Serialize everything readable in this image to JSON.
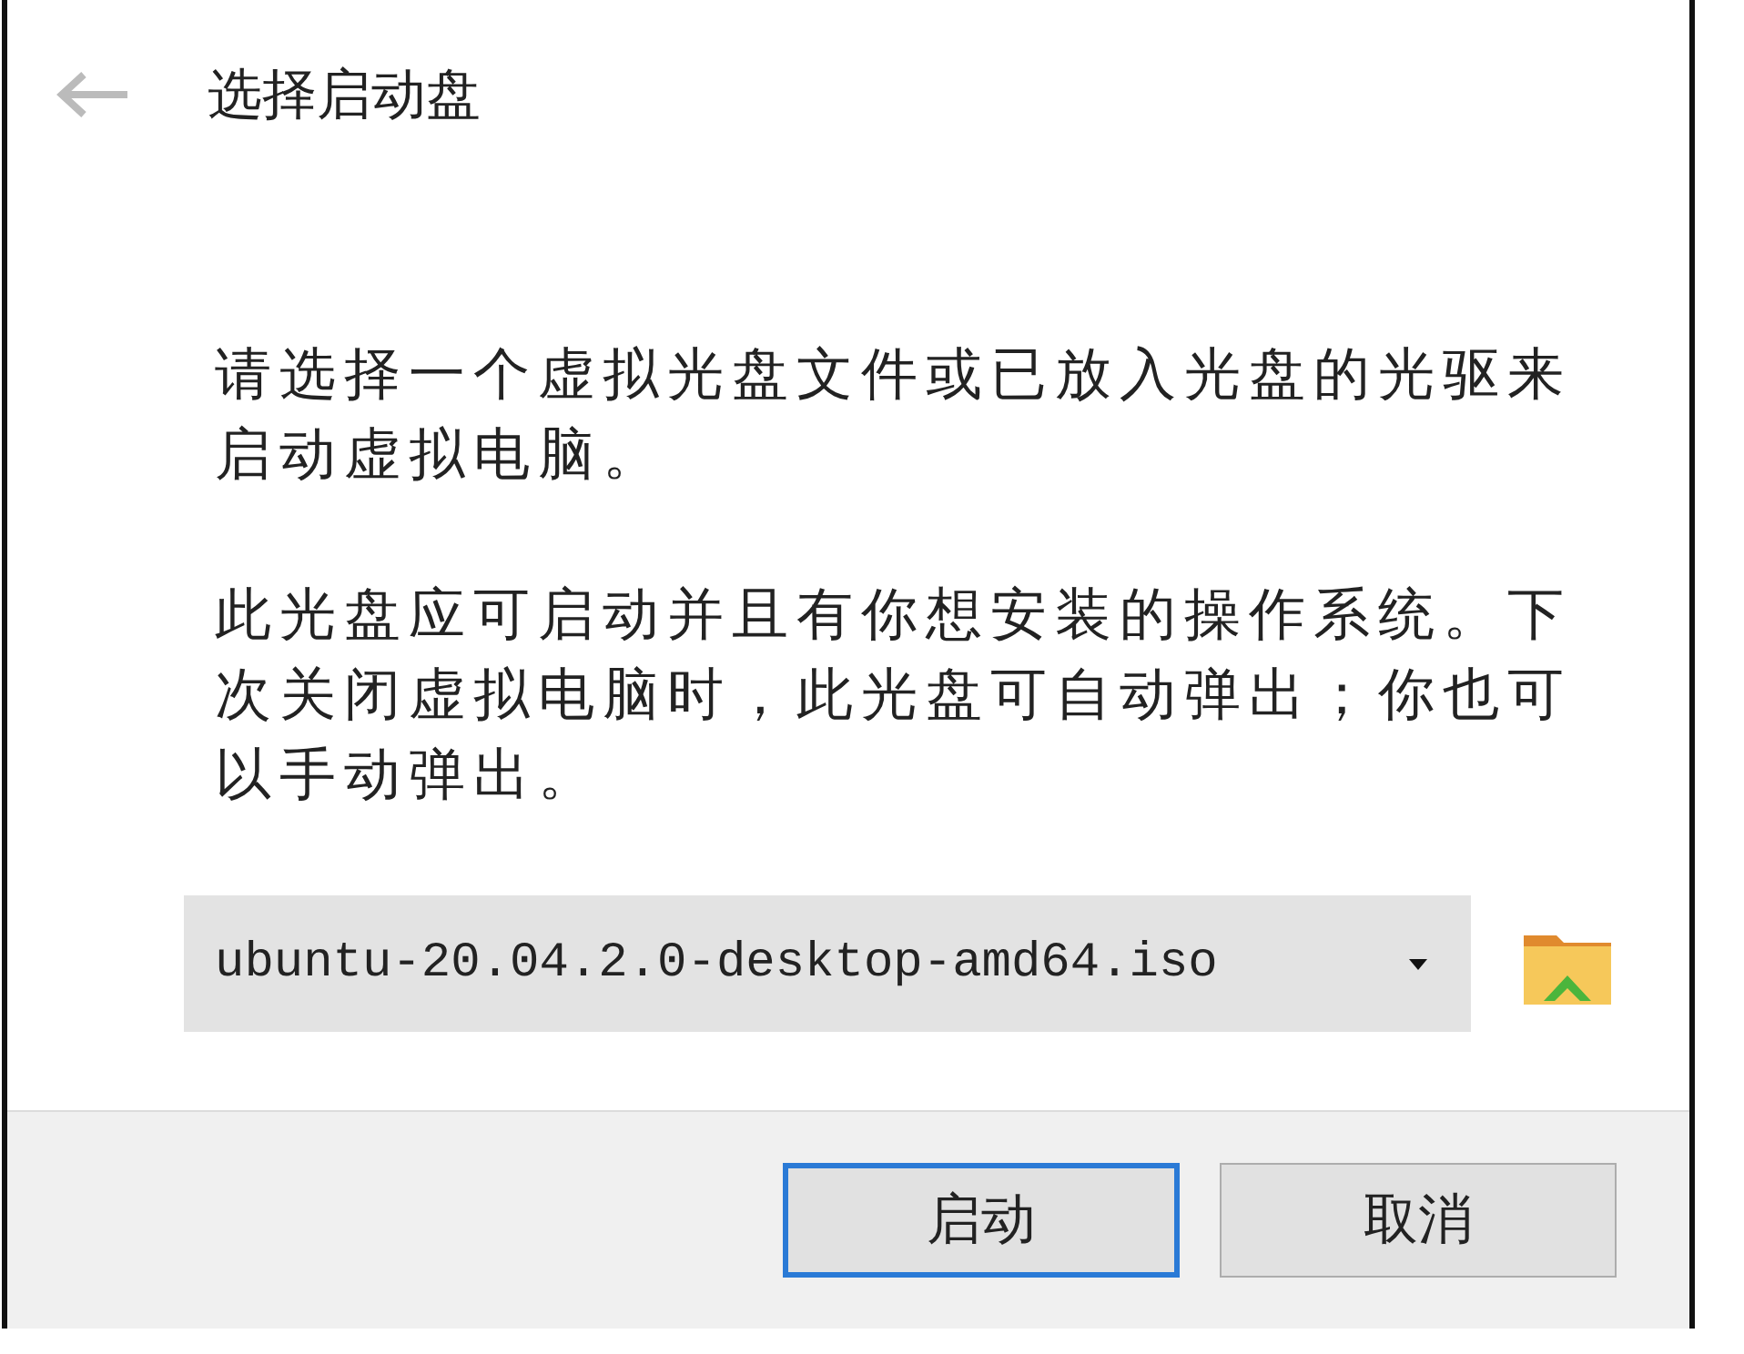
{
  "window": {
    "title": "选择启动盘"
  },
  "paragraphs": [
    "请选择一个虚拟光盘文件或已放入光盘的光驱来启动虚拟电脑。",
    "此光盘应可启动并且有你想安装的操作系统。下次关闭虚拟电脑时，此光盘可自动弹出；你也可以手动弹出。"
  ],
  "disc_select": {
    "value": "ubuntu-20.04.2.0-desktop-amd64.iso"
  },
  "buttons": [
    {
      "label": "启动",
      "default": true
    },
    {
      "label": "取消",
      "default": false
    }
  ]
}
